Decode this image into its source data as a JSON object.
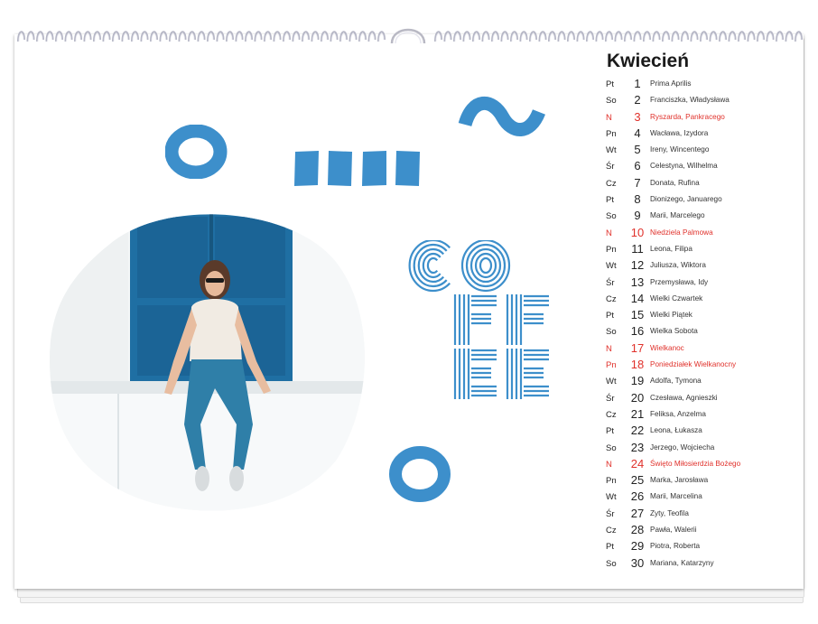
{
  "calendar": {
    "month": "Kwiecień",
    "holiday_color": "#e0312b",
    "accent_color": "#3d8fcb",
    "days": [
      {
        "weekday": "Pt",
        "day": "1",
        "names": "Prima Aprilis",
        "holiday": false
      },
      {
        "weekday": "So",
        "day": "2",
        "names": "Franciszka, Władysława",
        "holiday": false
      },
      {
        "weekday": "N",
        "day": "3",
        "names": "Ryszarda, Pankracego",
        "holiday": true
      },
      {
        "weekday": "Pn",
        "day": "4",
        "names": "Wacława, Izydora",
        "holiday": false
      },
      {
        "weekday": "Wt",
        "day": "5",
        "names": "Ireny, Wincentego",
        "holiday": false
      },
      {
        "weekday": "Śr",
        "day": "6",
        "names": "Celestyna, Wilhelma",
        "holiday": false
      },
      {
        "weekday": "Cz",
        "day": "7",
        "names": "Donata, Rufina",
        "holiday": false
      },
      {
        "weekday": "Pt",
        "day": "8",
        "names": "Dionizego, Januarego",
        "holiday": false
      },
      {
        "weekday": "So",
        "day": "9",
        "names": "Marii, Marcelego",
        "holiday": false
      },
      {
        "weekday": "N",
        "day": "10",
        "names": "Niedziela Palmowa",
        "holiday": true
      },
      {
        "weekday": "Pn",
        "day": "11",
        "names": "Leona, Filipa",
        "holiday": false
      },
      {
        "weekday": "Wt",
        "day": "12",
        "names": "Juliusza, Wiktora",
        "holiday": false
      },
      {
        "weekday": "Śr",
        "day": "13",
        "names": "Przemysława, Idy",
        "holiday": false
      },
      {
        "weekday": "Cz",
        "day": "14",
        "names": "Wielki Czwartek",
        "holiday": false
      },
      {
        "weekday": "Pt",
        "day": "15",
        "names": "Wielki Piątek",
        "holiday": false
      },
      {
        "weekday": "So",
        "day": "16",
        "names": "Wielka Sobota",
        "holiday": false
      },
      {
        "weekday": "N",
        "day": "17",
        "names": "Wielkanoc",
        "holiday": true
      },
      {
        "weekday": "Pn",
        "day": "18",
        "names": "Poniedziałek Wielkanocny",
        "holiday": true
      },
      {
        "weekday": "Wt",
        "day": "19",
        "names": "Adolfa, Tymona",
        "holiday": false
      },
      {
        "weekday": "Śr",
        "day": "20",
        "names": "Czesława, Agnieszki",
        "holiday": false
      },
      {
        "weekday": "Cz",
        "day": "21",
        "names": "Feliksa, Anzelma",
        "holiday": false
      },
      {
        "weekday": "Pt",
        "day": "22",
        "names": "Leona, Łukasza",
        "holiday": false
      },
      {
        "weekday": "So",
        "day": "23",
        "names": "Jerzego, Wojciecha",
        "holiday": false
      },
      {
        "weekday": "N",
        "day": "24",
        "names": "Święto Miłosierdzia Bożego",
        "holiday": true
      },
      {
        "weekday": "Pn",
        "day": "25",
        "names": "Marka, Jarosława",
        "holiday": false
      },
      {
        "weekday": "Wt",
        "day": "26",
        "names": "Marii, Marcelina",
        "holiday": false
      },
      {
        "weekday": "Śr",
        "day": "27",
        "names": "Zyty, Teofila",
        "holiday": false
      },
      {
        "weekday": "Cz",
        "day": "28",
        "names": "Pawła, Walerii",
        "holiday": false
      },
      {
        "weekday": "Pt",
        "day": "29",
        "names": "Piotra, Roberta",
        "holiday": false
      },
      {
        "weekday": "So",
        "day": "30",
        "names": "Mariana, Katarzyny",
        "holiday": false
      }
    ]
  },
  "artwork": {
    "coffee_lettering": [
      "CO",
      "FF",
      "EE"
    ],
    "photo_subject": "woman-sitting-by-blue-door"
  }
}
